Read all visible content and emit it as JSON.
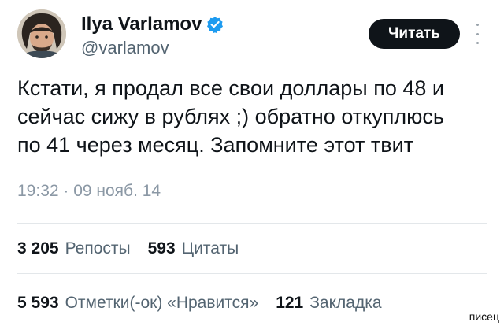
{
  "author": {
    "display_name": "Ilya Varlamov",
    "handle": "@varlamov",
    "verified_color": "#1d9bf0",
    "verified_icon": "verified-badge-icon"
  },
  "follow_button": {
    "label": "Читать"
  },
  "tweet": {
    "lines": [
      "Кстати, я продал все свои доллары по 48 и",
      "сейчас сижу в рублях ;) обратно откуплюсь",
      "по 41 через месяц. Запомните этот твит"
    ],
    "timestamp": "19:32 · 09 нояб. 14"
  },
  "stats": {
    "reposts": {
      "count": "3 205",
      "label": "Репосты"
    },
    "quotes": {
      "count": "593",
      "label": "Цитаты"
    },
    "likes": {
      "count": "5 593",
      "label": "Отметки(-ок) «Нравится»"
    },
    "bookmarks": {
      "count": "121",
      "label": "Закладка"
    }
  },
  "watermark": "писец"
}
